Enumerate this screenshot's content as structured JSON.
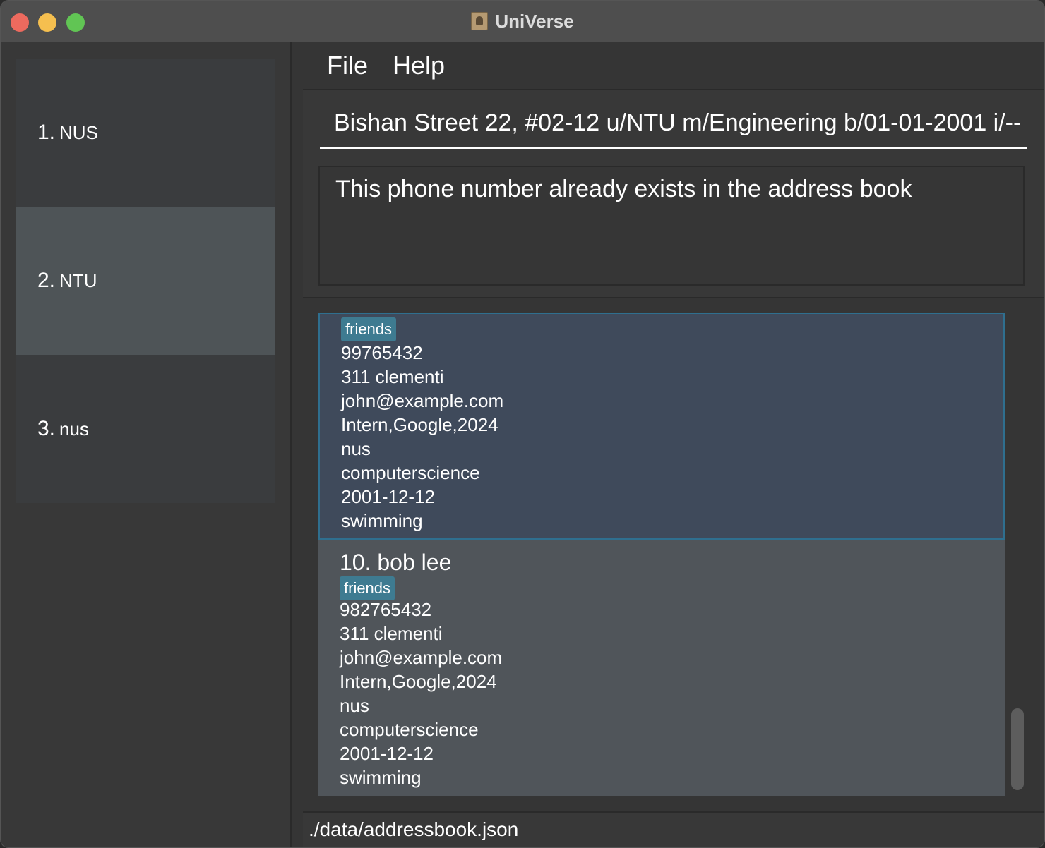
{
  "window": {
    "title": "UniVerse"
  },
  "sidebar": {
    "items": [
      {
        "number": "1.",
        "label": "NUS",
        "selected": false
      },
      {
        "number": "2.",
        "label": "NTU",
        "selected": true
      },
      {
        "number": "3.",
        "label": "nus",
        "selected": false
      }
    ]
  },
  "menu": {
    "file": "File",
    "help": "Help"
  },
  "command": {
    "value": "Bishan Street 22, #02-12 u/NTU m/Engineering b/01-01-2001 i/--"
  },
  "result": {
    "message": "This phone number already exists in the address book"
  },
  "contacts": [
    {
      "tag": "friends",
      "phone": "99765432",
      "address": "311 clementi",
      "email": "john@example.com",
      "work": "Intern,Google,2024",
      "university": "nus",
      "major": "computerscience",
      "birthday": "2001-12-12",
      "interest": "swimming"
    },
    {
      "name": "10. bob lee",
      "tag": "friends",
      "phone": "982765432",
      "address": "311 clementi",
      "email": "john@example.com",
      "work": "Intern,Google,2024",
      "university": "nus",
      "major": "computerscience",
      "birthday": "2001-12-12",
      "interest": "swimming"
    }
  ],
  "status": {
    "path": "./data/addressbook.json"
  },
  "colors": {
    "selected_card": "#3f4a5b",
    "selected_border": "#2f6f8f",
    "card": "#50555a",
    "tag": "#3e7b91",
    "sidebar_selected": "#4e5457"
  }
}
